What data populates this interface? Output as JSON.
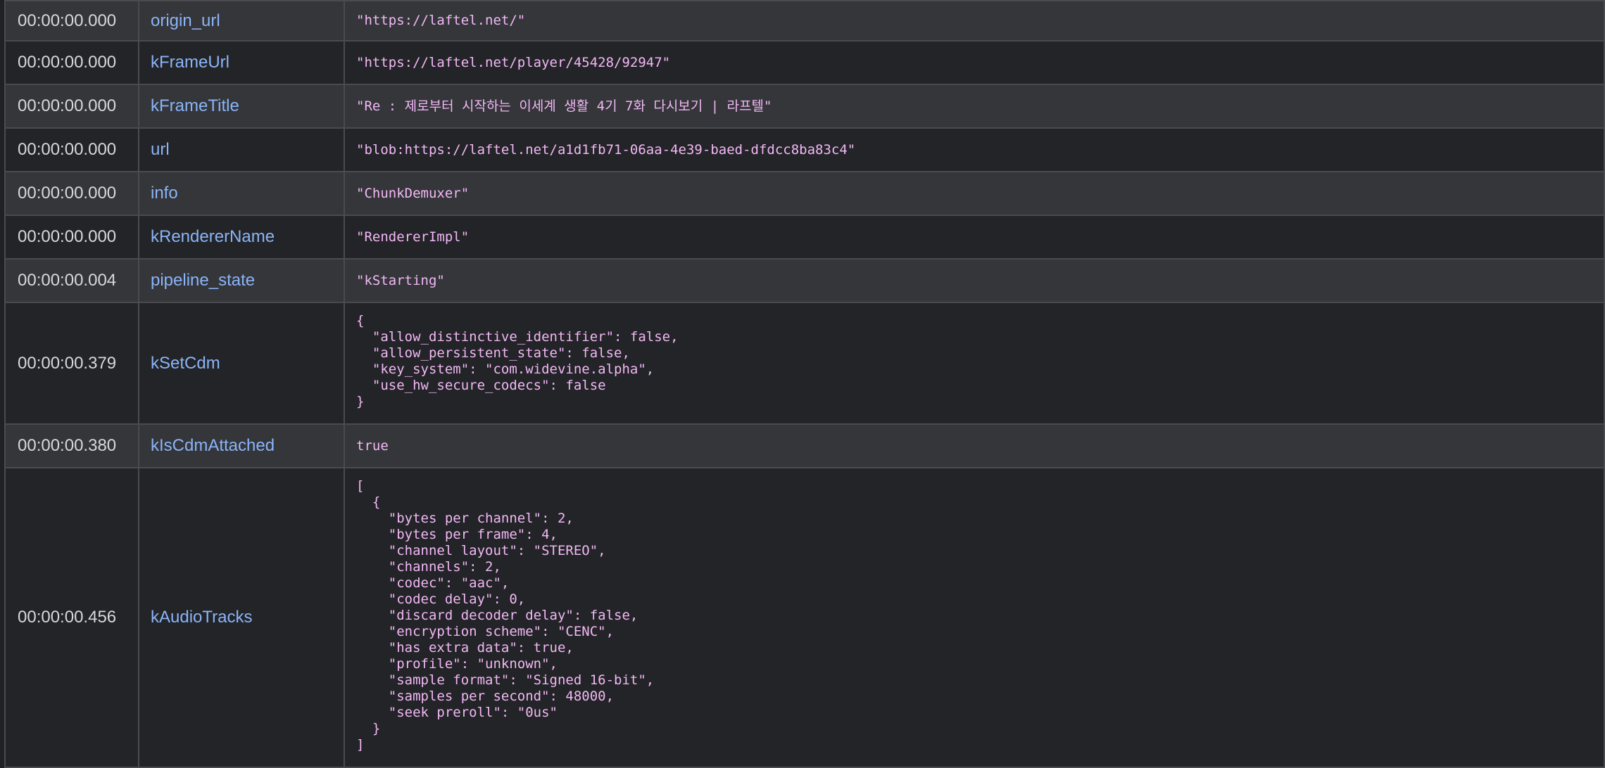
{
  "rows": [
    {
      "time": "00:00:00.000",
      "property": "origin_url",
      "value": "\"https://laftel.net/\""
    },
    {
      "time": "00:00:00.000",
      "property": "kFrameUrl",
      "value": "\"https://laftel.net/player/45428/92947\""
    },
    {
      "time": "00:00:00.000",
      "property": "kFrameTitle",
      "value": "\"Re : 제로부터 시작하는 이세계 생활 4기 7화 다시보기 | 라프텔\""
    },
    {
      "time": "00:00:00.000",
      "property": "url",
      "value": "\"blob:https://laftel.net/a1d1fb71-06aa-4e39-baed-dfdcc8ba83c4\""
    },
    {
      "time": "00:00:00.000",
      "property": "info",
      "value": "\"ChunkDemuxer\""
    },
    {
      "time": "00:00:00.000",
      "property": "kRendererName",
      "value": "\"RendererImpl\""
    },
    {
      "time": "00:00:00.004",
      "property": "pipeline_state",
      "value": "\"kStarting\""
    },
    {
      "time": "00:00:00.379",
      "property": "kSetCdm",
      "value": "{\n  \"allow_distinctive_identifier\": false,\n  \"allow_persistent_state\": false,\n  \"key_system\": \"com.widevine.alpha\",\n  \"use_hw_secure_codecs\": false\n}"
    },
    {
      "time": "00:00:00.380",
      "property": "kIsCdmAttached",
      "value": "true"
    },
    {
      "time": "00:00:00.456",
      "property": "kAudioTracks",
      "value": "[\n  {\n    \"bytes per channel\": 2,\n    \"bytes per frame\": 4,\n    \"channel layout\": \"STEREO\",\n    \"channels\": 2,\n    \"codec\": \"aac\",\n    \"codec delay\": 0,\n    \"discard decoder delay\": false,\n    \"encryption scheme\": \"CENC\",\n    \"has extra data\": true,\n    \"profile\": \"unknown\",\n    \"sample format\": \"Signed 16-bit\",\n    \"samples per second\": 48000,\n    \"seek preroll\": \"0us\"\n  }\n]"
    }
  ]
}
